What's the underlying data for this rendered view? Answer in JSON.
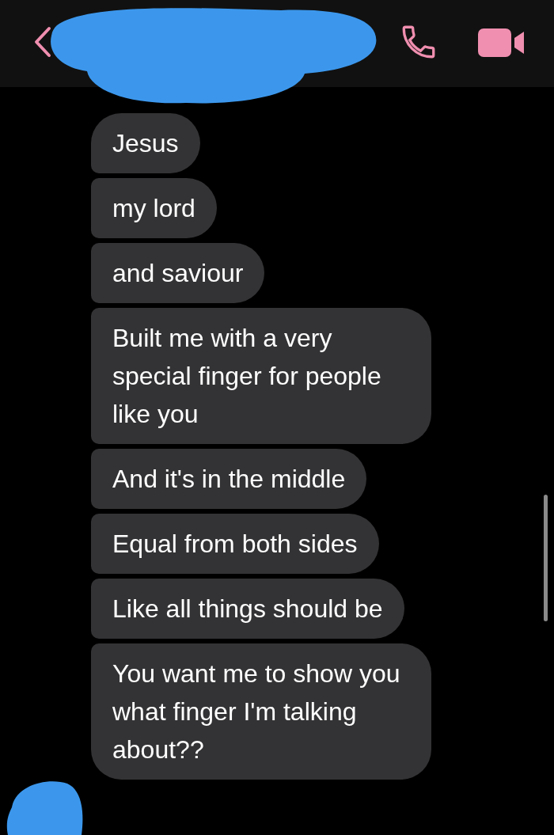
{
  "messages": [
    {
      "text": "Jesus"
    },
    {
      "text": "my lord"
    },
    {
      "text": "and saviour"
    },
    {
      "text": "Built me with a very special finger for people like you"
    },
    {
      "text": "And it's in the middle"
    },
    {
      "text": "Equal from both sides"
    },
    {
      "text": "Like all things should be"
    },
    {
      "text": "You want me to show you what finger I'm talking about??"
    }
  ]
}
